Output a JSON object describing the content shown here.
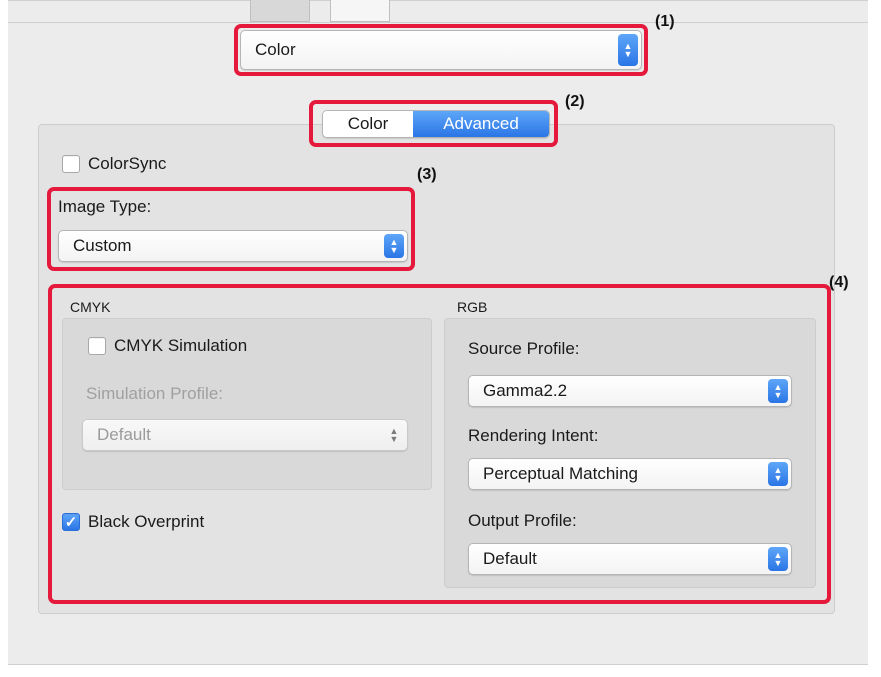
{
  "print_mode_popup": {
    "value": "Color"
  },
  "segment": {
    "items": [
      "Color",
      "Advanced"
    ],
    "selected": "Advanced"
  },
  "callouts": [
    "(1)",
    "(2)",
    "(3)",
    "(4)"
  ],
  "colorsync": {
    "label": "ColorSync",
    "checked": false
  },
  "image_type": {
    "label": "Image Type:",
    "value": "Custom"
  },
  "cmyk": {
    "title": "CMYK",
    "simulation": {
      "label": "CMYK Simulation",
      "checked": false
    },
    "profile_label": "Simulation Profile:",
    "profile_value": "Default"
  },
  "black_overprint": {
    "label": "Black Overprint",
    "checked": true
  },
  "rgb": {
    "title": "RGB",
    "source_label": "Source Profile:",
    "source_value": "Gamma2.2",
    "intent_label": "Rendering Intent:",
    "intent_value": "Perceptual Matching",
    "output_label": "Output Profile:",
    "output_value": "Default"
  },
  "icons": {
    "popup_arrows": "up-down-chevron-icon",
    "checkmark": "checkmark-icon"
  },
  "colors": {
    "accent": "#2a75e6",
    "callout_box": "#e5193c"
  }
}
